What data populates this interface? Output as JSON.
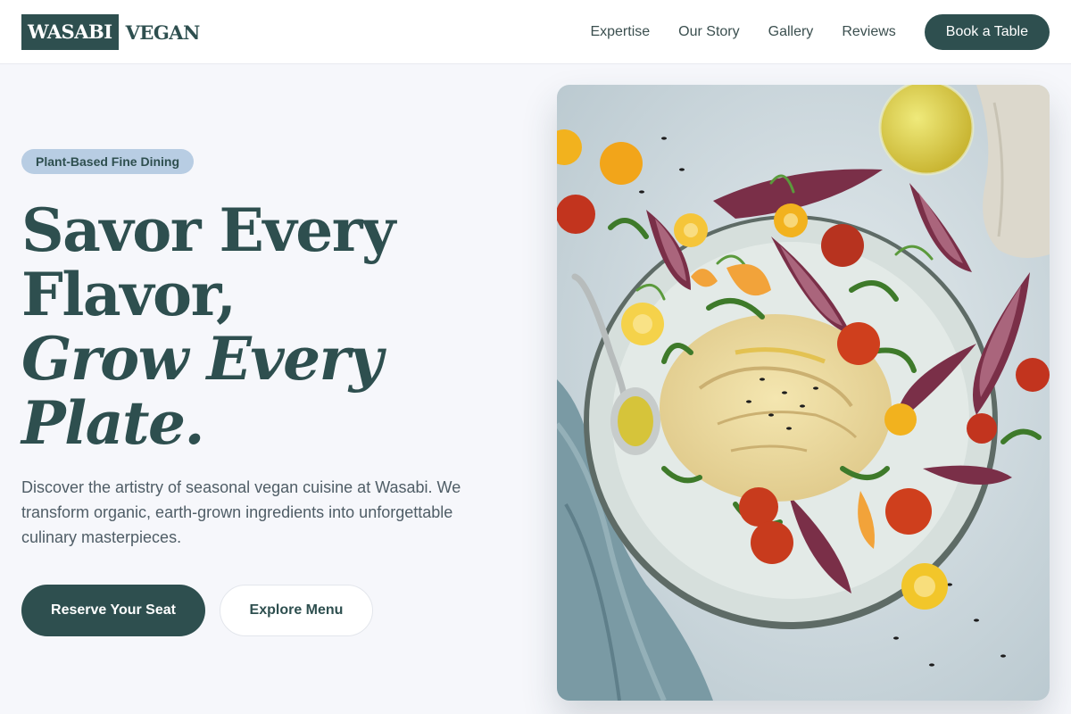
{
  "brand": {
    "logo_box_text": "WASABI",
    "logo_text": "VEGAN",
    "primary_color": "#2e4f4f",
    "badge_color": "#b8cde3",
    "background": "#f6f7fb"
  },
  "nav": {
    "items": [
      {
        "label": "Expertise"
      },
      {
        "label": "Our Story"
      },
      {
        "label": "Gallery"
      },
      {
        "label": "Reviews"
      }
    ],
    "cta_label": "Book a Table"
  },
  "hero": {
    "badge": "Plant-Based Fine Dining",
    "headline": {
      "line1": "Savor Every",
      "line2": "Flavor,",
      "line3": "Grow Every",
      "line4": "Plate."
    },
    "description": "Discover the artistry of seasonal vegan cuisine at Wasabi. We transform organic, earth-grown ingredients into unforgettable culinary masterpieces.",
    "primary_button": "Reserve Your Seat",
    "secondary_button": "Explore Menu"
  }
}
